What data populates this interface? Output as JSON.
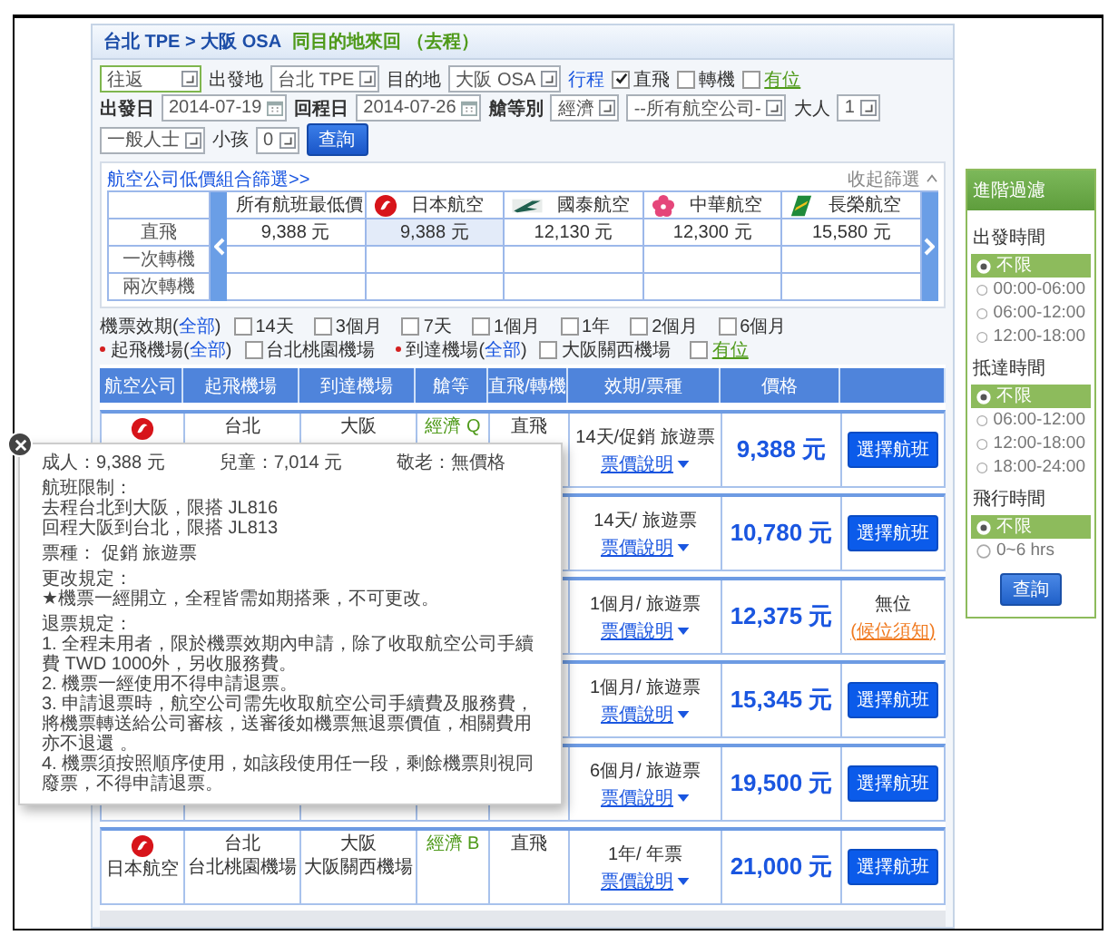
{
  "header": {
    "route": "台北 TPE > 大阪 OSA",
    "note": "同目的地來回 （去程）"
  },
  "form": {
    "rows": [
      {
        "items": [
          {
            "kind": "select",
            "value": "往返"
          },
          {
            "kind": "label",
            "text": "出發地"
          },
          {
            "kind": "select",
            "value": "台北 TPE"
          },
          {
            "kind": "label",
            "text": "目的地"
          },
          {
            "kind": "select",
            "value": "大阪 OSA"
          },
          {
            "kind": "link",
            "text": "行程"
          },
          {
            "kind": "check",
            "text": "直飛",
            "checked": true
          },
          {
            "kind": "check",
            "text": "轉機",
            "checked": false
          },
          {
            "kind": "check-link",
            "text": "有位",
            "checked": false
          }
        ]
      },
      {
        "items": [
          {
            "kind": "strong",
            "text": "出發日"
          },
          {
            "kind": "date",
            "value": "2014-07-19"
          },
          {
            "kind": "strong",
            "text": "回程日"
          },
          {
            "kind": "date",
            "value": "2014-07-26"
          },
          {
            "kind": "strong",
            "text": "艙等別"
          },
          {
            "kind": "select",
            "value": "經濟"
          },
          {
            "kind": "select",
            "value": "--所有航空公司-"
          },
          {
            "kind": "label",
            "text": "大人"
          },
          {
            "kind": "select",
            "value": "1"
          },
          {
            "kind": "select",
            "value": "一般人士"
          },
          {
            "kind": "label",
            "text": "小孩"
          },
          {
            "kind": "select",
            "value": "0"
          },
          {
            "kind": "button",
            "text": "查詢"
          }
        ]
      }
    ]
  },
  "matrix": {
    "title_link": "航空公司低價組合篩選>>",
    "collapse": "收起篩選",
    "columns": [
      "所有航班最低價",
      "日本航空",
      "國泰航空",
      "中華航空",
      "長榮航空"
    ],
    "rows": [
      {
        "label": "直飛",
        "cells": [
          {
            "text": "9,388 元",
            "selected": false
          },
          {
            "text": "9,388 元",
            "selected": true
          },
          {
            "text": "12,130 元",
            "selected": false
          },
          {
            "text": "12,300 元",
            "selected": false
          },
          {
            "text": "15,580 元",
            "selected": false
          }
        ]
      },
      {
        "label": "一次轉機"
      },
      {
        "label": "兩次轉機"
      }
    ]
  },
  "filters": {
    "validity": {
      "label": "機票效期(",
      "link": "全部",
      "tail": ")",
      "options": [
        {
          "text": "14天",
          "checked": false
        },
        {
          "text": "3個月",
          "checked": false
        },
        {
          "text": "7天",
          "checked": false
        },
        {
          "text": "1個月",
          "checked": false
        },
        {
          "text": "1年",
          "checked": false
        },
        {
          "text": "2個月",
          "checked": false
        },
        {
          "text": "6個月",
          "checked": false
        }
      ]
    },
    "airports": [
      {
        "kind": "group",
        "label": "起飛機場(",
        "link": "全部",
        "tail": ")"
      },
      {
        "kind": "check",
        "text": "台北桃園機場",
        "checked": false
      },
      {
        "kind": "group",
        "label": "到達機場(",
        "link": "全部",
        "tail": ")"
      },
      {
        "kind": "check",
        "text": "大阪關西機場",
        "checked": false
      },
      {
        "kind": "check-link",
        "text": "有位",
        "checked": false
      }
    ]
  },
  "results": {
    "columns": [
      "航空公司",
      "起飛機場",
      "到達機場",
      "艙等",
      "直飛/轉機",
      "效期/票種",
      "價格"
    ],
    "rows": [
      {
        "from": [
          "台北"
        ],
        "to": [
          "大阪"
        ],
        "cabin": "經濟 Q",
        "route": "直飛",
        "validity": "14天/促銷 旅遊票",
        "fare_link": "票價說明",
        "price": "9,388 元",
        "action": {
          "kind": "button",
          "text": "選擇航班"
        }
      },
      {
        "validity": "14天/ 旅遊票",
        "fare_link": "票價說明",
        "price": "10,780 元",
        "action": {
          "kind": "button",
          "text": "選擇航班"
        }
      },
      {
        "validity": "1個月/ 旅遊票",
        "fare_link": "票價說明",
        "price": "12,375 元",
        "action": {
          "kind": "waitlist",
          "text": "無位",
          "link": "(候位須知)"
        }
      },
      {
        "validity": "1個月/ 旅遊票",
        "fare_link": "票價說明",
        "price": "15,345 元",
        "action": {
          "kind": "button",
          "text": "選擇航班"
        }
      },
      {
        "validity": "6個月/ 旅遊票",
        "fare_link": "票價說明",
        "price": "19,500 元",
        "action": {
          "kind": "button",
          "text": "選擇航班"
        }
      },
      {
        "airline": "日本航空",
        "from": [
          "台北",
          "台北桃園機場"
        ],
        "to": [
          "大阪",
          "大阪關西機場"
        ],
        "cabin": "經濟 B",
        "route": "直飛",
        "validity": "1年/ 年票",
        "fare_link": "票價說明",
        "price": "21,000 元",
        "action": {
          "kind": "button",
          "text": "選擇航班"
        }
      }
    ]
  },
  "popup": {
    "prices": [
      "成人：9,388 元",
      "兒童：7,014 元",
      "敬老：無價格"
    ],
    "sections": [
      [
        "航班限制：",
        "去程台北到大阪，限搭 JL816",
        "回程大阪到台北，限搭 JL813"
      ],
      [
        "票種： 促銷 旅遊票"
      ],
      [
        "更改規定：",
        "★機票一經開立，全程皆需如期搭乘，不可更改。"
      ],
      [
        "退票規定：",
        "1. 全程未用者，限於機票效期內申請，除了收取航空公司手續費 TWD 1000外，另收服務費。",
        "2. 機票一經使用不得申請退票。",
        "3. 申請退票時，航空公司需先收取航空公司手續費及服務費，將機票轉送給公司審核，送審後如機票無退票價值，相關費用亦不退還 。",
        "4. 機票須按照順序使用，如該段使用任一段，剩餘機票則視同廢票，不得申請退票。"
      ]
    ]
  },
  "sidebar": {
    "title": "進階過濾",
    "groups": [
      {
        "title": "出發時間",
        "options": [
          {
            "label": "不限",
            "selected": true
          },
          {
            "label": "00:00-06:00",
            "selected": false
          },
          {
            "label": "06:00-12:00",
            "selected": false
          },
          {
            "label": "12:00-18:00",
            "selected": false
          }
        ]
      },
      {
        "title": "抵達時間",
        "options": [
          {
            "label": "不限",
            "selected": true
          },
          {
            "label": "06:00-12:00",
            "selected": false
          },
          {
            "label": "12:00-18:00",
            "selected": false
          },
          {
            "label": "18:00-24:00",
            "selected": false
          }
        ]
      },
      {
        "title": "飛行時間",
        "options": [
          {
            "label": "不限",
            "selected": true
          },
          {
            "label": "0~6 hrs",
            "selected": false
          }
        ]
      }
    ],
    "button": "查詢"
  }
}
